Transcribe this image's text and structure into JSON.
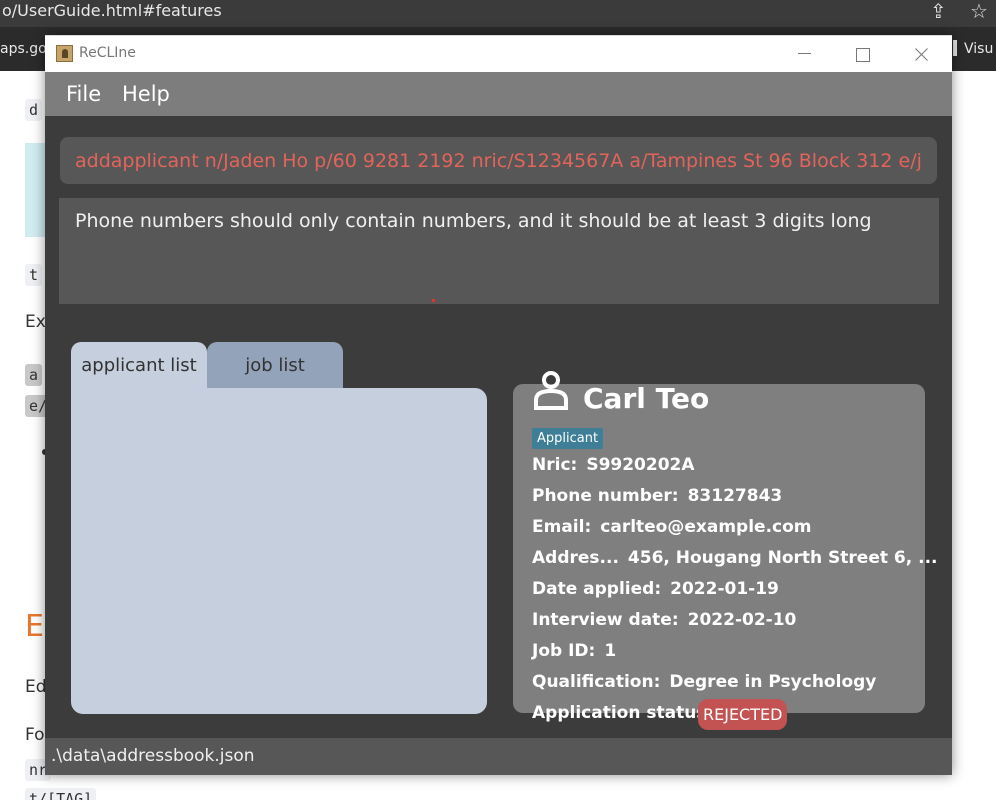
{
  "browser": {
    "url_fragment": "o/UserGuide.html#features",
    "bookmark_left": "aps.go",
    "bookmark_right": "Visu"
  },
  "doc_fragments": {
    "d": "d",
    "t": "t",
    "ex": "Ex",
    "a": "a",
    "e": "e/",
    "heading": "E",
    "ed": "Ed",
    "fo": "Fo",
    "nri": "nr",
    "tag": "t/[TAG]"
  },
  "window": {
    "title": "ReCLIne"
  },
  "menu": {
    "file": "File",
    "help": "Help"
  },
  "command": {
    "value": "addapplicant n/Jaden Ho p/60 9281 2192 nric/S1234567A a/Tampines St 96 Block 312 e/jadenho@example.com"
  },
  "result": {
    "text": "Phone numbers should only contain numbers, and it should be at least 3 digits long"
  },
  "tabs": {
    "applicant": "applicant list",
    "job": "job list"
  },
  "card": {
    "name": "Carl Teo",
    "tag": "Applicant",
    "rows": [
      {
        "label": "Nric:",
        "value": "S9920202A"
      },
      {
        "label": "Phone number:",
        "value": "83127843"
      },
      {
        "label": "Email:",
        "value": "carlteo@example.com"
      },
      {
        "label": "Addres...",
        "value": "456, Hougang North Street 6, ..."
      },
      {
        "label": "Date applied:",
        "value": "2022-01-19"
      },
      {
        "label": "Interview date:",
        "value": "2022-02-10"
      },
      {
        "label": "Job ID:",
        "value": "1"
      },
      {
        "label": "Qualification:",
        "value": "Degree in Psychology"
      },
      {
        "label": "Application status:",
        "value": ""
      }
    ],
    "status": "REJECTED"
  },
  "statusbar": {
    "path": ".\\data\\addressbook.json"
  },
  "colors": {
    "window_bg": "#3c3c3c",
    "menubar": "#7d7d7d",
    "command_text": "#e2645a",
    "tag": "#3e7e96",
    "status_rejected": "#c35352",
    "tab_active": "#c5cfdd",
    "tab_inactive": "#93a3ba"
  }
}
